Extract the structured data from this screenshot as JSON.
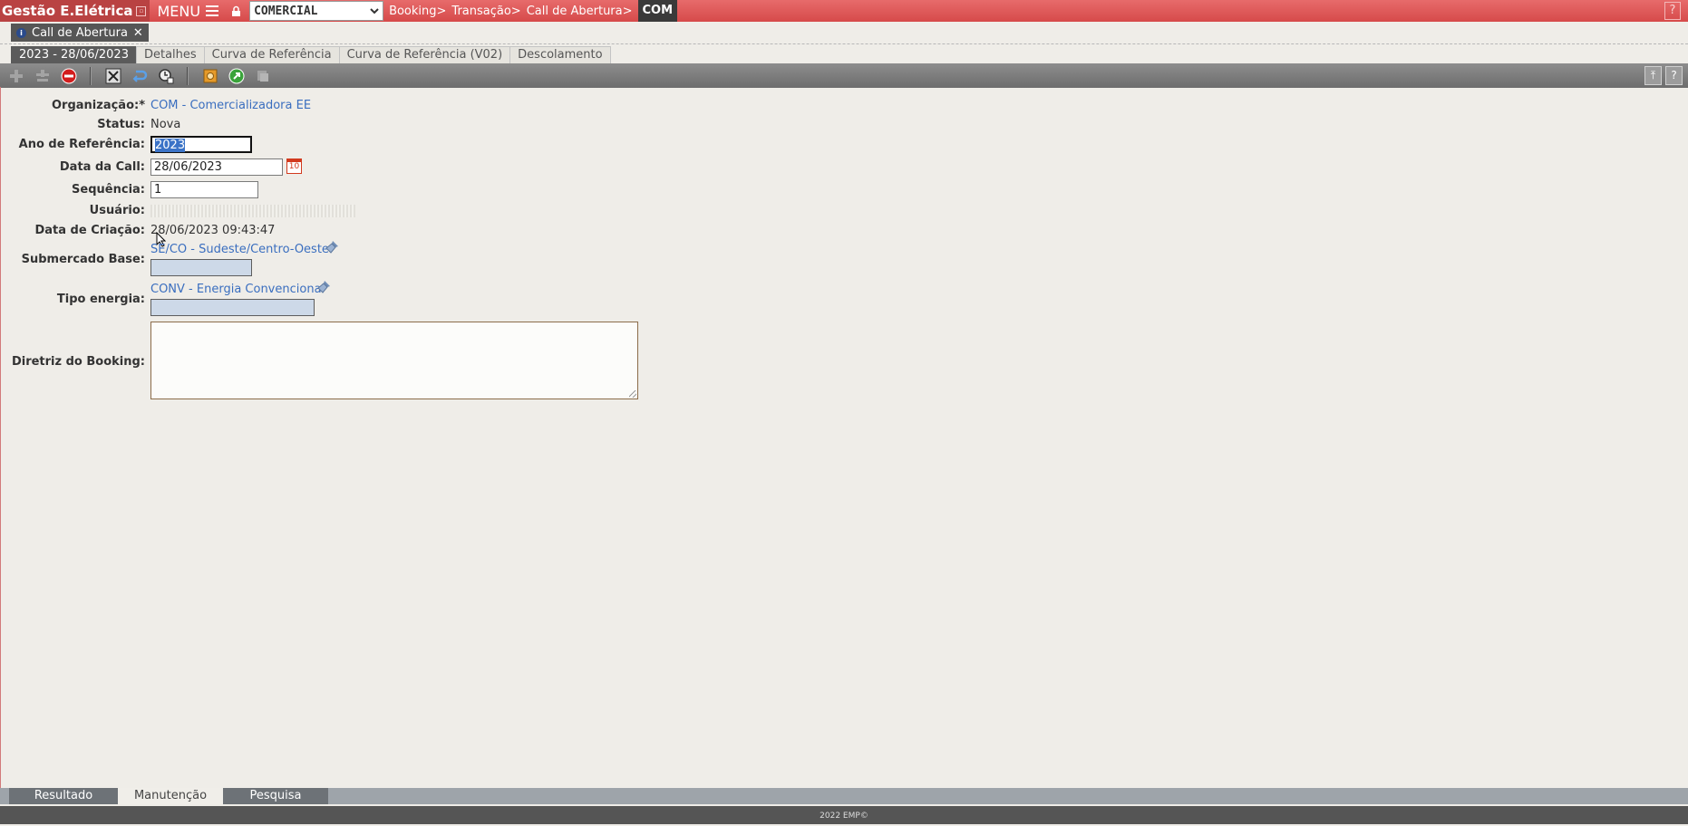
{
  "app": {
    "title": "Gestão E.Elétrica",
    "menu_label": "MENU",
    "org_selector_value": "COMERCIAL",
    "breadcrumb": [
      "Booking>",
      "Transação>",
      "Call de Abertura>"
    ],
    "breadcrumb_current": "COM",
    "help_label": "?"
  },
  "document_tab": {
    "label": "Call de Abertura",
    "close": "✕"
  },
  "subtabs": [
    "2023 - 28/06/2023",
    "Detalhes",
    "Curva de Referência",
    "Curva de Referência (V02)",
    "Descolamento"
  ],
  "form": {
    "organizacao": {
      "label": "Organização:*",
      "value": "COM - Comercializadora EE"
    },
    "status": {
      "label": "Status:",
      "value": "Nova"
    },
    "ano_referencia": {
      "label": "Ano de Referência:",
      "value": "2023"
    },
    "data_call": {
      "label": "Data da Call:",
      "value": "28/06/2023",
      "calendar_day": "10"
    },
    "sequencia": {
      "label": "Sequência:",
      "value": "1"
    },
    "usuario": {
      "label": "Usuário:",
      "value": ""
    },
    "data_criacao": {
      "label": "Data de Criação:",
      "value": "28/06/2023 09:43:47"
    },
    "submercado_base": {
      "label": "Submercado Base:",
      "value": "SE/CO - Sudeste/Centro-Oeste"
    },
    "tipo_energia": {
      "label": "Tipo energia:",
      "value": "CONV - Energia Convencional"
    },
    "diretriz_booking": {
      "label": "Diretriz do Booking:",
      "value": ""
    }
  },
  "bottom_tabs": [
    "Resultado",
    "Manutenção",
    "Pesquisa"
  ],
  "footer": "2022 EMP©",
  "colors": {
    "topbar": "#d64a4a",
    "title_bg": "#b94242",
    "link": "#3a6ebf",
    "toolbar": "#7a7a7a",
    "page_bg": "#efede8"
  }
}
